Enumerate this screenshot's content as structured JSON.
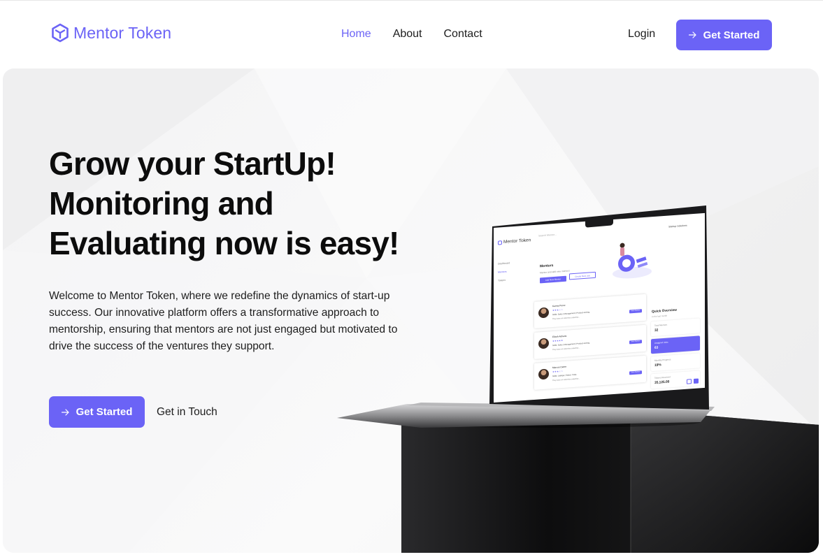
{
  "brand": {
    "name": "Mentor Token",
    "accent_color": "#6b63f6",
    "logo_icon": "hexagon-logo-icon"
  },
  "nav": {
    "links": [
      {
        "label": "Home",
        "active": true
      },
      {
        "label": "About",
        "active": false
      },
      {
        "label": "Contact",
        "active": false
      }
    ],
    "login_label": "Login",
    "cta_label": "Get Started",
    "cta_icon": "arrow-right-icon"
  },
  "hero": {
    "headline_lines": [
      "Grow your StartUp!",
      "Monitoring and",
      "Evaluating now is easy!"
    ],
    "intro": "Welcome to Mentor Token, where we redefine the dynamics of start-up success. Our innovative platform offers a transformative approach to mentorship, ensuring that mentors are not just engaged but motivated to drive the success of the ventures they support.",
    "cta_label": "Get Started",
    "cta_icon": "arrow-right-icon",
    "secondary_label": "Get in Touch"
  },
  "laptop_screen": {
    "app_name": "Mentor Token",
    "search_placeholder": "Search Mentor...",
    "user_name": "Startup Solutions",
    "sidebar": [
      "Dashboard",
      "Mentors",
      "Tokens"
    ],
    "page_title": "Mentors",
    "page_subtitle": "Mentor and add new mentors",
    "add_button": "Add New Mentor",
    "second_button": "Create New Job",
    "mentors": [
      {
        "name": "Karma Perez",
        "stars": "★★★☆☆",
        "skills": "Skills: Sales | Management | Product owning",
        "bio": "They have an extensive expertise...",
        "action": "View Mentor"
      },
      {
        "name": "Elizah Adrians",
        "stars": "★★★★★",
        "skills": "Skills: Sales | Management | Product owning",
        "bio": "They have an extensive expertise...",
        "action": "View Mentor"
      },
      {
        "name": "Marcus Carter",
        "stars": "★★★☆☆",
        "skills": "Skills: Listings | Sales | Code",
        "bio": "They have an extensive expertise...",
        "action": "View Mentor"
      }
    ],
    "quick_overview_title": "Quick Overview",
    "quick_overview_sub": "In the last month",
    "stats": [
      {
        "label": "Total Mentors",
        "value": "32",
        "accent": false
      },
      {
        "label": "Assigned Jobs",
        "value": "63",
        "accent": true
      },
      {
        "label": "Monthly Progress",
        "value": "19%",
        "accent": false
      },
      {
        "label": "Tokens Received",
        "value": "35,125.00",
        "accent": false
      }
    ]
  }
}
